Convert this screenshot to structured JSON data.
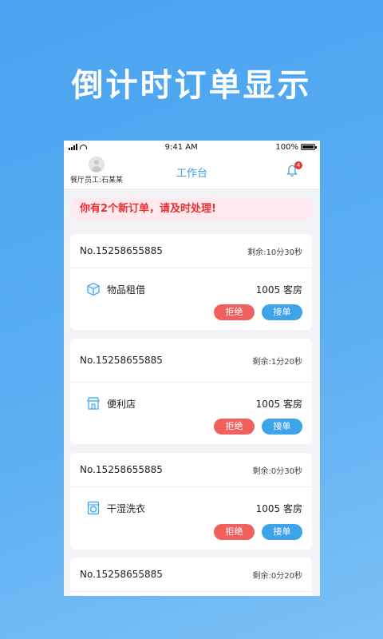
{
  "headline": "倒计时订单显示",
  "status_bar": {
    "time": "9:41 AM",
    "battery": "100%"
  },
  "header": {
    "staff": "餐厅员工:石某某",
    "title": "工作台",
    "badge": "4"
  },
  "alert": "你有2个新订单，请及时处理!",
  "orders": [
    {
      "no": "No.15258655885",
      "remaining": "剩余:10分30秒",
      "service": "物品租借",
      "room": "1005 客房",
      "reject": "拒绝",
      "accept": "接单",
      "icon": "box-icon"
    },
    {
      "no": "No.15258655885",
      "remaining": "剩余:1分20秒",
      "service": "便利店",
      "room": "1005 客房",
      "reject": "拒绝",
      "accept": "接单",
      "icon": "store-icon"
    },
    {
      "no": "No.15258655885",
      "remaining": "剩余:0分30秒",
      "service": "干湿洗衣",
      "room": "1005 客房",
      "reject": "拒绝",
      "accept": "接单",
      "icon": "washer-icon"
    },
    {
      "no": "No.15258655885",
      "remaining": "剩余:0分20秒"
    }
  ],
  "colors": {
    "accent": "#3ea4ea",
    "reject": "#f0605e",
    "alert_text": "#e8312f"
  }
}
